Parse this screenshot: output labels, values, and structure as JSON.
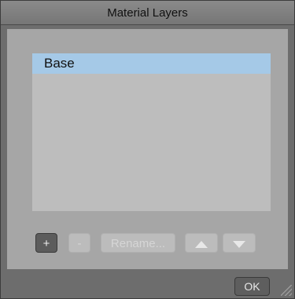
{
  "window": {
    "title": "Material Layers"
  },
  "layers": [
    {
      "label": "Base",
      "selected": true
    }
  ],
  "toolbar": {
    "add_label": "+",
    "remove_label": "-",
    "rename_label": "Rename..."
  },
  "footer": {
    "ok_label": "OK"
  },
  "colors": {
    "selection": "#a5c9e7",
    "panel": "#a6a6a6",
    "list_bg": "#bdbdbd",
    "dialog_bg": "#6d6d6d"
  }
}
